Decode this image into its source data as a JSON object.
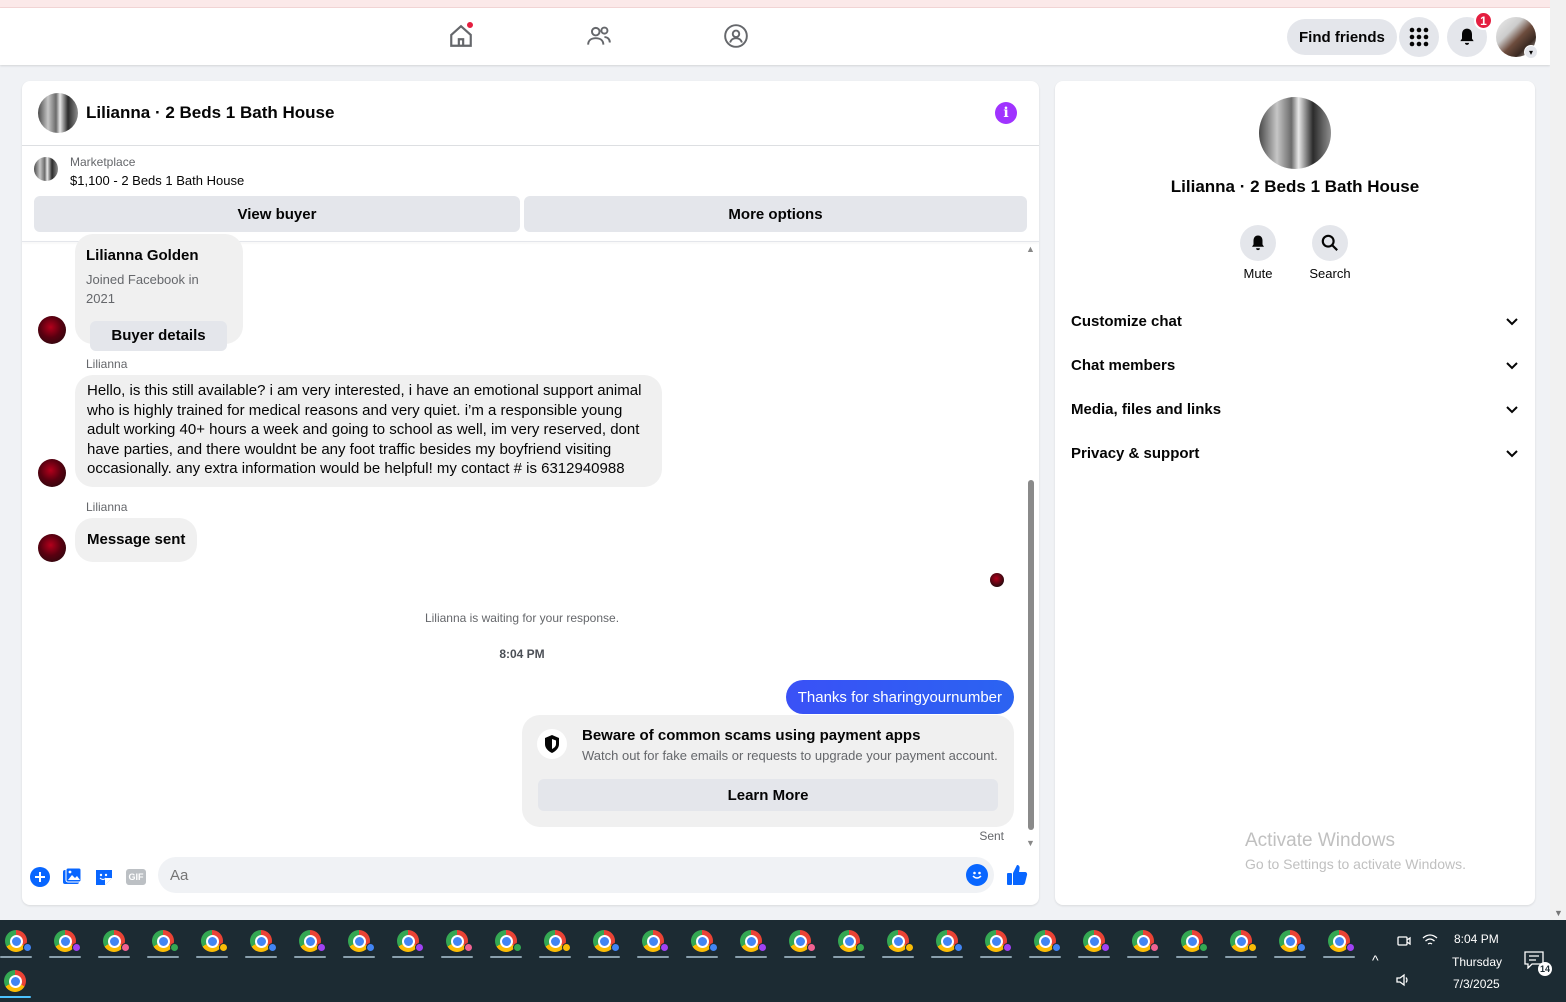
{
  "nav": {
    "find_friends": "Find friends",
    "notification_count": "1"
  },
  "chat": {
    "title": "Lilianna · 2 Beds 1 Bath House",
    "marketplace_label": "Marketplace",
    "listing": "$1,100 - 2 Beds 1 Bath House",
    "view_buyer": "View buyer",
    "more_options": "More options"
  },
  "buyer_card": {
    "name": "Lilianna Golden",
    "joined": "Joined Facebook in 2021",
    "button": "Buyer details"
  },
  "messages": {
    "sender1": "Lilianna",
    "msg1_lines": [
      "Hello, is this still available? i am very interested, i have an emotional support animal",
      "who is highly trained for medical reasons and very quiet. i’m a responsible young",
      "adult working 40+ hours a week and going to school as well, im very reserved, dont",
      "have parties, and there wouldnt be any foot traffic besides my boyfriend visiting",
      "occasionally. any extra information would be helpful! my contact # is 6312940988"
    ],
    "sender2": "Lilianna",
    "msg2": "Message sent",
    "waiting_note": "Lilianna is waiting for your response.",
    "timestamp": "8:04 PM",
    "outgoing": "Thanks for sharingyournumber",
    "scam_title": "Beware of common scams using payment apps",
    "scam_sub": "Watch out for fake emails or requests to upgrade your payment account.",
    "learn_more": "Learn More",
    "sent_status": "Sent"
  },
  "composer": {
    "placeholder": "Aa",
    "gif_label": "GIF"
  },
  "side": {
    "title": "Lilianna · 2 Beds 1 Bath House",
    "mute": "Mute",
    "search": "Search",
    "rows": [
      "Customize chat",
      "Chat members",
      "Media, files and links",
      "Privacy & support"
    ]
  },
  "watermark": {
    "line1": "Activate Windows",
    "line2": "Go to Settings to activate Windows."
  },
  "taskbar": {
    "time": "8:04 PM",
    "day": "Thursday",
    "date": "7/3/2025",
    "notification_count": "14"
  },
  "colors": {
    "accent": "#0866ff",
    "outgoing_bubble": "#3a51f6",
    "info_icon": "#a033ff",
    "badge": "#e41e3f",
    "taskbar": "#1c2b33"
  }
}
